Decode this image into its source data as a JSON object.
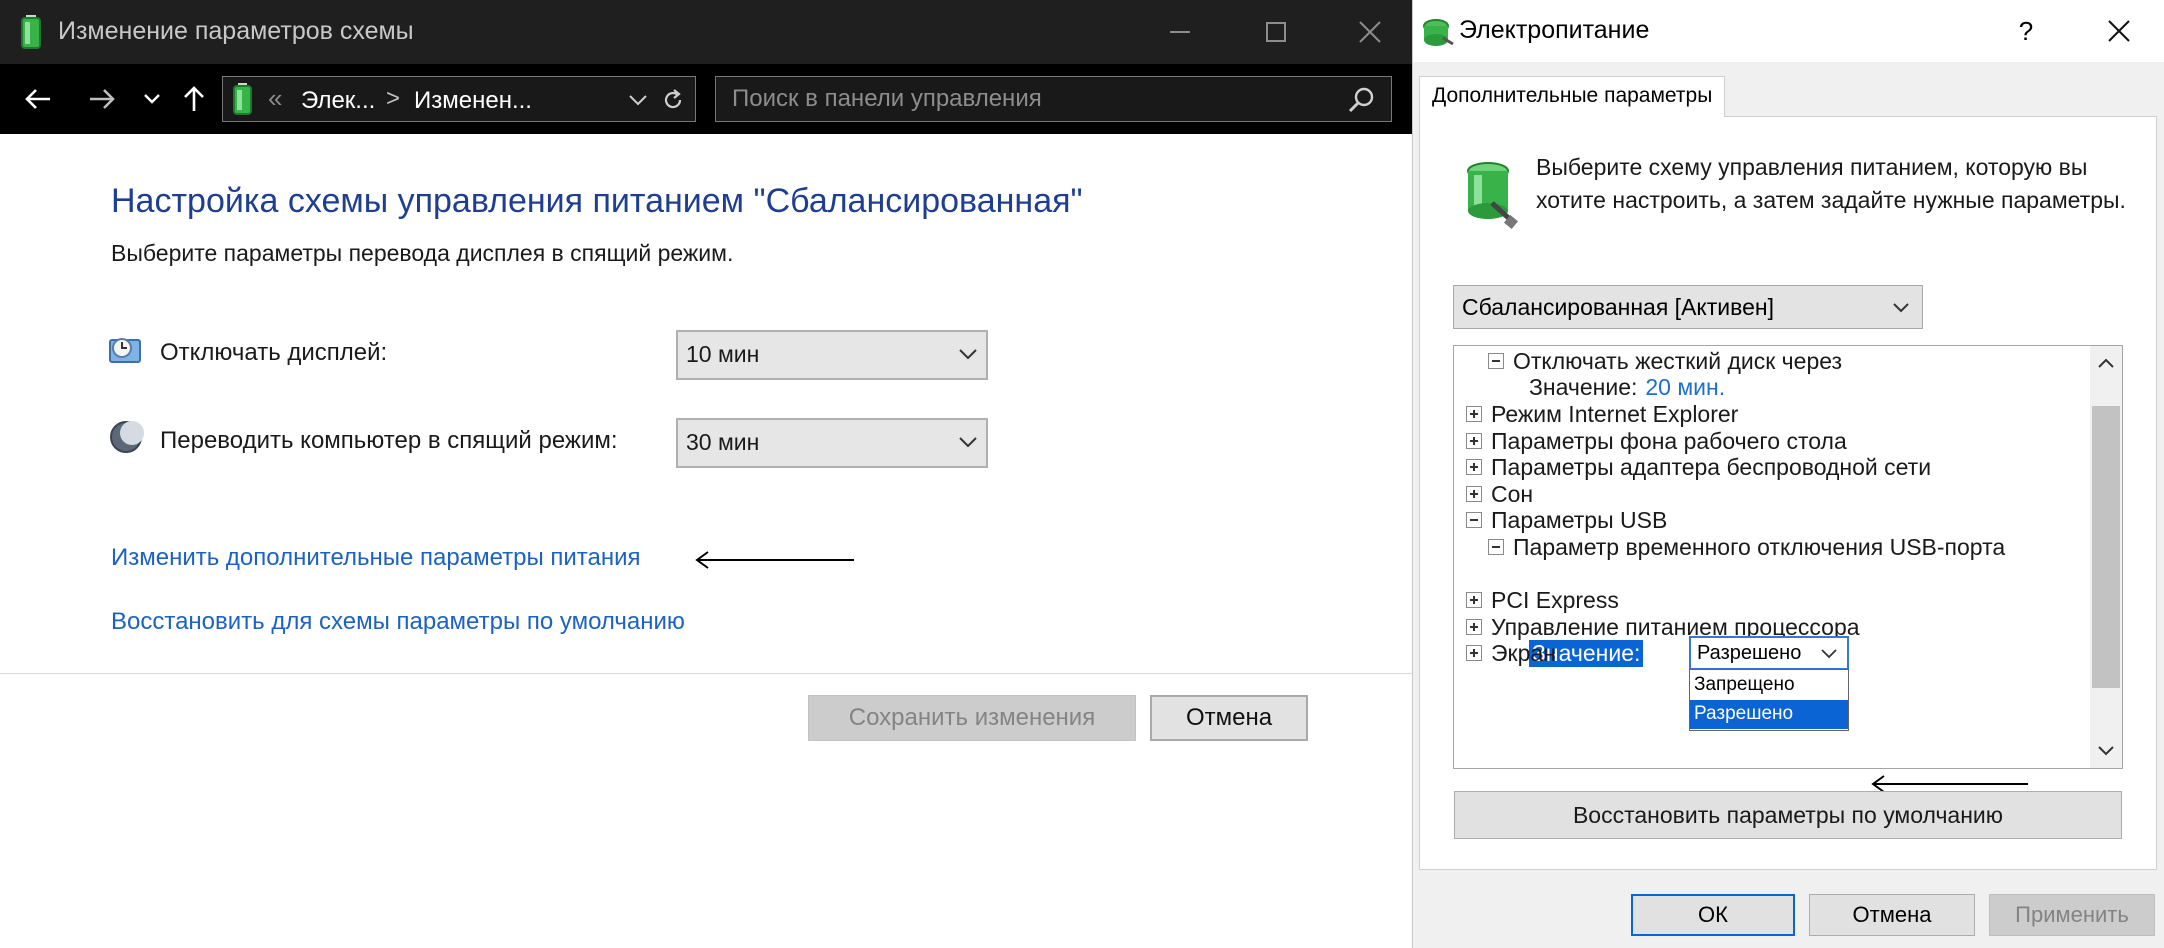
{
  "left_window": {
    "title": "Изменение параметров схемы",
    "nav": {
      "address_separator": "«",
      "crumb_1": "Элек...",
      "crumb_separator": ">",
      "crumb_2": "Изменен...",
      "search_placeholder": "Поиск в панели управления"
    },
    "heading": "Настройка схемы управления питанием \"Сбалансированная\"",
    "subtitle": "Выберите параметры перевода дисплея в спящий режим.",
    "settings": {
      "display_off": {
        "label": "Отключать дисплей:",
        "value": "10 мин"
      },
      "sleep": {
        "label": "Переводить компьютер в спящий режим:",
        "value": "30 мин"
      }
    },
    "links": {
      "advanced": "Изменить дополнительные параметры питания",
      "restore": "Восстановить для схемы параметры по умолчанию"
    },
    "buttons": {
      "save": "Сохранить изменения",
      "cancel": "Отмена"
    }
  },
  "dialog": {
    "title": "Электропитание",
    "help": "?",
    "tab": "Дополнительные параметры",
    "description": "Выберите схему управления питанием, которую вы хотите настроить, а затем задайте нужные параметры.",
    "scheme": "Сбалансированная [Активен]",
    "tree": {
      "hdd": "Отключать жесткий диск через",
      "hdd_value_label": "Значение:",
      "hdd_value": "20 мин.",
      "ie": "Режим Internet Explorer",
      "desktop": "Параметры фона рабочего стола",
      "wireless": "Параметры адаптера беспроводной сети",
      "sleep": "Сон",
      "usb": "Параметры USB",
      "usb_suspend": "Параметр временного отключения USB-порта",
      "usb_value_label": "Значение:",
      "usb_value": "Разрешено",
      "usb_options": [
        "Запрещено",
        "Разрешено"
      ],
      "pci": "PCI Express",
      "cpu": "Управление питанием процессора",
      "screen": "Экран"
    },
    "restore_button": "Восстановить параметры по умолчанию",
    "buttons": {
      "ok": "ОК",
      "cancel": "Отмена",
      "apply": "Применить"
    }
  },
  "colors": {
    "accent": "#0a64d3",
    "link": "#1c62c4",
    "heading": "#1e3f91",
    "titlebar_dark": "#1f1f1f"
  }
}
